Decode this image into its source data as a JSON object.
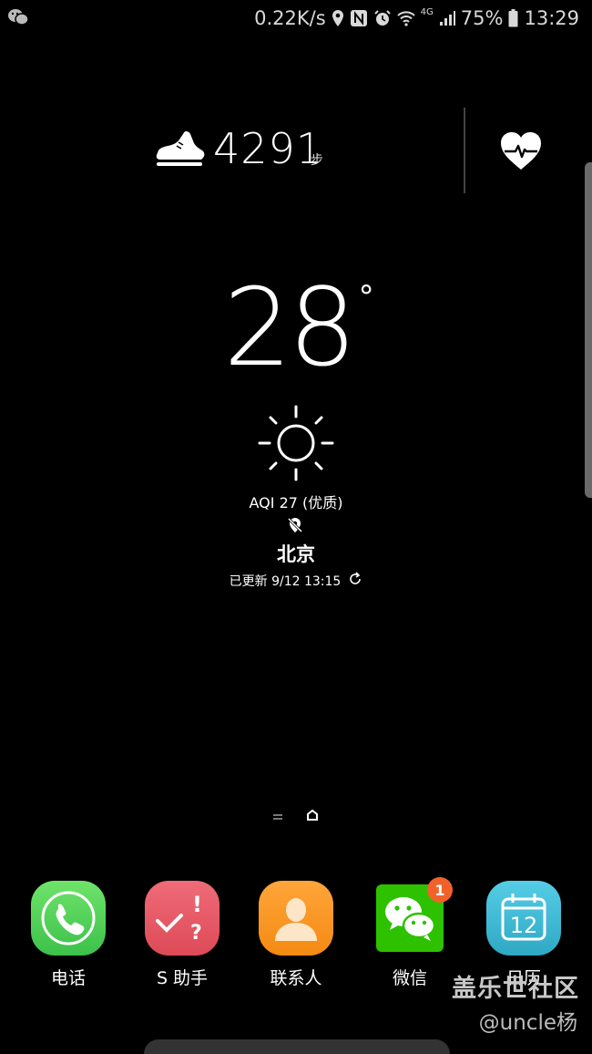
{
  "status_bar": {
    "left_icon": "wechat-notification-icon",
    "network_speed": "0.22K/s",
    "icons": [
      "location-icon",
      "nfc-icon",
      "alarm-icon",
      "wifi-icon",
      "4g-icon",
      "signal-icon"
    ],
    "network_type": "4G",
    "battery": "75%",
    "time": "13:29"
  },
  "health": {
    "steps": "4291",
    "steps_unit": "步",
    "shoe_icon": "shoe-icon",
    "heart_icon": "heart-rate-icon"
  },
  "weather": {
    "temperature": "28",
    "degree_symbol": "°",
    "condition_icon": "sun-icon",
    "aqi": "AQI 27 (优质)",
    "location_icon": "location-off-icon",
    "city": "北京",
    "updated": "已更新 9/12 13:15",
    "refresh_icon": "refresh-icon"
  },
  "page_indicator": {
    "pages": [
      "menu-page",
      "home-page"
    ],
    "active": "home-page"
  },
  "dock": {
    "apps": [
      {
        "label": "电话",
        "icon": "phone-icon",
        "color": "#4cd964"
      },
      {
        "label": "S 助手",
        "icon": "s-assistant-icon",
        "color": "#ea5a67"
      },
      {
        "label": "联系人",
        "icon": "contacts-icon",
        "color": "#f7931e"
      },
      {
        "label": "微信",
        "icon": "wechat-icon",
        "color": "#2dc100",
        "badge": "1"
      },
      {
        "label": "日历",
        "icon": "calendar-icon",
        "color": "#3fb9d4",
        "calendar_day": "12"
      }
    ]
  },
  "watermark": {
    "title": "盖乐世社区",
    "handle": "@uncle杨"
  }
}
